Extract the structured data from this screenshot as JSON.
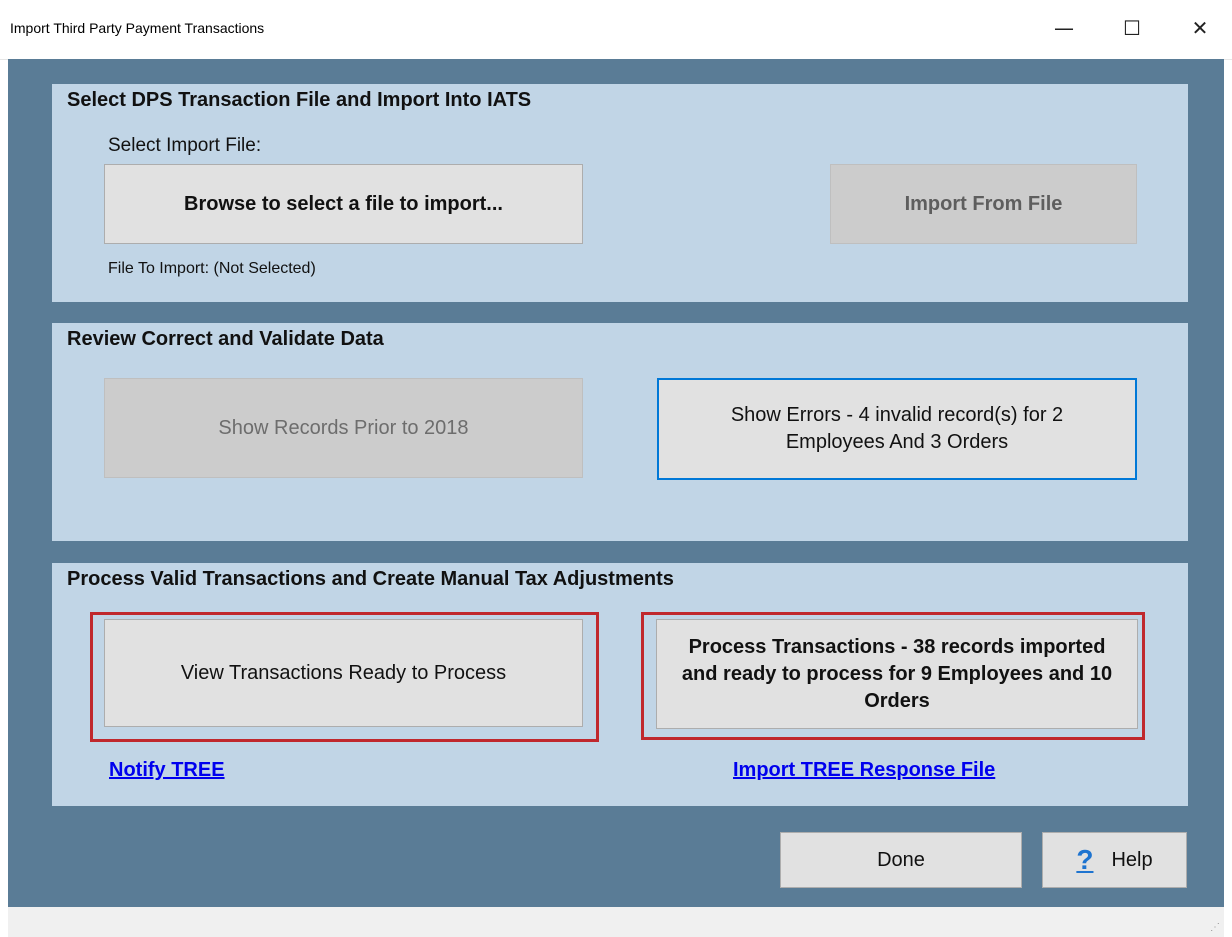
{
  "window": {
    "title": "Import Third Party Payment Transactions",
    "minimize_glyph": "—",
    "maximize_glyph": "☐",
    "close_glyph": "✕"
  },
  "section1": {
    "title": "Select DPS Transaction File and Import Into IATS",
    "select_label": "Select Import File:",
    "browse_button": "Browse to select a file to import...",
    "import_button": "Import From File",
    "file_status": "File To Import: (Not Selected)"
  },
  "section2": {
    "title": "Review Correct and Validate Data",
    "prior_button": "Show Records Prior to 2018",
    "errors_button": "Show Errors - 4 invalid record(s) for 2 Employees And 3 Orders"
  },
  "section3": {
    "title": "Process Valid Transactions and Create Manual Tax Adjustments",
    "view_button": "View Transactions Ready to Process",
    "process_button": "Process Transactions - 38 records imported and ready to process for 9 Employees and 10 Orders",
    "notify_link": "Notify TREE",
    "response_link": "Import TREE Response File"
  },
  "footer": {
    "done_button": "Done",
    "help_button": "Help",
    "help_icon_glyph": "?"
  },
  "colors": {
    "client_bg": "#5a7c96",
    "panel_bg": "#c1d5e6",
    "highlight": "#c0282d",
    "focus_border": "#0078d7",
    "link": "#0000ee"
  }
}
